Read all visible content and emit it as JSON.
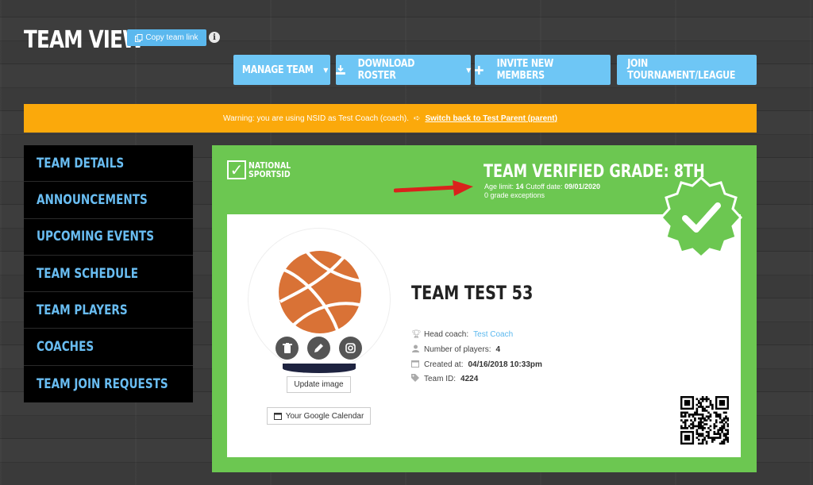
{
  "header": {
    "title": "TEAM VIEW",
    "copy_link_label": "Copy team link",
    "info_glyph": "i"
  },
  "actions": [
    {
      "label": "MANAGE TEAM",
      "icon": "",
      "has_caret": true
    },
    {
      "label": "DOWNLOAD ROSTER",
      "icon": "download-icon",
      "has_caret": true
    },
    {
      "label": "INVITE NEW MEMBERS",
      "icon": "plus-icon",
      "has_caret": false
    },
    {
      "label": "JOIN TOURNAMENT/LEAGUE",
      "icon": "",
      "has_caret": false
    }
  ],
  "warning": {
    "text": "Warning: you are using NSID as Test Coach (coach).",
    "switch_label": "Switch back to Test Parent (parent)"
  },
  "sidebar": {
    "items": [
      {
        "label": "TEAM DETAILS"
      },
      {
        "label": "ANNOUNCEMENTS"
      },
      {
        "label": "UPCOMING EVENTS"
      },
      {
        "label": "TEAM SCHEDULE"
      },
      {
        "label": "TEAM PLAYERS"
      },
      {
        "label": "COACHES"
      },
      {
        "label": "TEAM JOIN REQUESTS"
      }
    ]
  },
  "panel": {
    "logo_line1": "NATIONAL",
    "logo_line2": "SPORTSID",
    "verified_title": "TEAM VERIFIED GRADE: 8TH",
    "age_limit_label": "Age limit:",
    "age_limit_value": "14",
    "cutoff_label": "Cutoff date:",
    "cutoff_value": "09/01/2020",
    "exceptions": "0 grade exceptions"
  },
  "team": {
    "name": "TEAM TEST 53",
    "update_image_label": "Update image",
    "calendar_label": "Your Google Calendar",
    "head_coach_label": "Head coach:",
    "head_coach_value": "Test Coach",
    "players_label": "Number of players:",
    "players_value": "4",
    "created_label": "Created at:",
    "created_value": "04/16/2018 10:33pm",
    "id_label": "Team ID:",
    "id_value": "4224"
  },
  "colors": {
    "accent_blue": "#6ec6f5",
    "warning": "#fba90b",
    "panel_green": "#6cc751",
    "sidebar_text": "#69bdf2",
    "arrow_red": "#d9221c"
  }
}
